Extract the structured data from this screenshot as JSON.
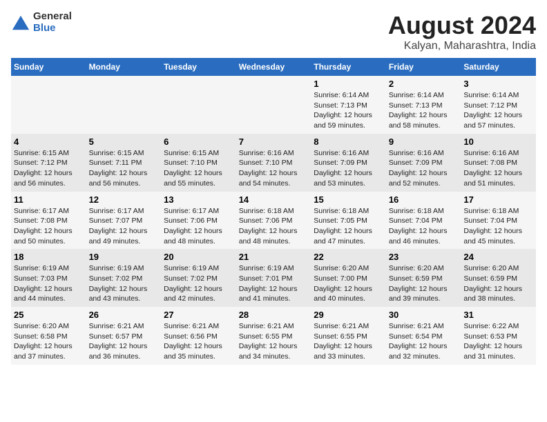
{
  "logo": {
    "general": "General",
    "blue": "Blue"
  },
  "title": "August 2024",
  "subtitle": "Kalyan, Maharashtra, India",
  "days_of_week": [
    "Sunday",
    "Monday",
    "Tuesday",
    "Wednesday",
    "Thursday",
    "Friday",
    "Saturday"
  ],
  "weeks": [
    [
      {
        "day": "",
        "info": ""
      },
      {
        "day": "",
        "info": ""
      },
      {
        "day": "",
        "info": ""
      },
      {
        "day": "",
        "info": ""
      },
      {
        "day": "1",
        "info": "Sunrise: 6:14 AM\nSunset: 7:13 PM\nDaylight: 12 hours\nand 59 minutes."
      },
      {
        "day": "2",
        "info": "Sunrise: 6:14 AM\nSunset: 7:13 PM\nDaylight: 12 hours\nand 58 minutes."
      },
      {
        "day": "3",
        "info": "Sunrise: 6:14 AM\nSunset: 7:12 PM\nDaylight: 12 hours\nand 57 minutes."
      }
    ],
    [
      {
        "day": "4",
        "info": "Sunrise: 6:15 AM\nSunset: 7:12 PM\nDaylight: 12 hours\nand 56 minutes."
      },
      {
        "day": "5",
        "info": "Sunrise: 6:15 AM\nSunset: 7:11 PM\nDaylight: 12 hours\nand 56 minutes."
      },
      {
        "day": "6",
        "info": "Sunrise: 6:15 AM\nSunset: 7:10 PM\nDaylight: 12 hours\nand 55 minutes."
      },
      {
        "day": "7",
        "info": "Sunrise: 6:16 AM\nSunset: 7:10 PM\nDaylight: 12 hours\nand 54 minutes."
      },
      {
        "day": "8",
        "info": "Sunrise: 6:16 AM\nSunset: 7:09 PM\nDaylight: 12 hours\nand 53 minutes."
      },
      {
        "day": "9",
        "info": "Sunrise: 6:16 AM\nSunset: 7:09 PM\nDaylight: 12 hours\nand 52 minutes."
      },
      {
        "day": "10",
        "info": "Sunrise: 6:16 AM\nSunset: 7:08 PM\nDaylight: 12 hours\nand 51 minutes."
      }
    ],
    [
      {
        "day": "11",
        "info": "Sunrise: 6:17 AM\nSunset: 7:08 PM\nDaylight: 12 hours\nand 50 minutes."
      },
      {
        "day": "12",
        "info": "Sunrise: 6:17 AM\nSunset: 7:07 PM\nDaylight: 12 hours\nand 49 minutes."
      },
      {
        "day": "13",
        "info": "Sunrise: 6:17 AM\nSunset: 7:06 PM\nDaylight: 12 hours\nand 48 minutes."
      },
      {
        "day": "14",
        "info": "Sunrise: 6:18 AM\nSunset: 7:06 PM\nDaylight: 12 hours\nand 48 minutes."
      },
      {
        "day": "15",
        "info": "Sunrise: 6:18 AM\nSunset: 7:05 PM\nDaylight: 12 hours\nand 47 minutes."
      },
      {
        "day": "16",
        "info": "Sunrise: 6:18 AM\nSunset: 7:04 PM\nDaylight: 12 hours\nand 46 minutes."
      },
      {
        "day": "17",
        "info": "Sunrise: 6:18 AM\nSunset: 7:04 PM\nDaylight: 12 hours\nand 45 minutes."
      }
    ],
    [
      {
        "day": "18",
        "info": "Sunrise: 6:19 AM\nSunset: 7:03 PM\nDaylight: 12 hours\nand 44 minutes."
      },
      {
        "day": "19",
        "info": "Sunrise: 6:19 AM\nSunset: 7:02 PM\nDaylight: 12 hours\nand 43 minutes."
      },
      {
        "day": "20",
        "info": "Sunrise: 6:19 AM\nSunset: 7:02 PM\nDaylight: 12 hours\nand 42 minutes."
      },
      {
        "day": "21",
        "info": "Sunrise: 6:19 AM\nSunset: 7:01 PM\nDaylight: 12 hours\nand 41 minutes."
      },
      {
        "day": "22",
        "info": "Sunrise: 6:20 AM\nSunset: 7:00 PM\nDaylight: 12 hours\nand 40 minutes."
      },
      {
        "day": "23",
        "info": "Sunrise: 6:20 AM\nSunset: 6:59 PM\nDaylight: 12 hours\nand 39 minutes."
      },
      {
        "day": "24",
        "info": "Sunrise: 6:20 AM\nSunset: 6:59 PM\nDaylight: 12 hours\nand 38 minutes."
      }
    ],
    [
      {
        "day": "25",
        "info": "Sunrise: 6:20 AM\nSunset: 6:58 PM\nDaylight: 12 hours\nand 37 minutes."
      },
      {
        "day": "26",
        "info": "Sunrise: 6:21 AM\nSunset: 6:57 PM\nDaylight: 12 hours\nand 36 minutes."
      },
      {
        "day": "27",
        "info": "Sunrise: 6:21 AM\nSunset: 6:56 PM\nDaylight: 12 hours\nand 35 minutes."
      },
      {
        "day": "28",
        "info": "Sunrise: 6:21 AM\nSunset: 6:55 PM\nDaylight: 12 hours\nand 34 minutes."
      },
      {
        "day": "29",
        "info": "Sunrise: 6:21 AM\nSunset: 6:55 PM\nDaylight: 12 hours\nand 33 minutes."
      },
      {
        "day": "30",
        "info": "Sunrise: 6:21 AM\nSunset: 6:54 PM\nDaylight: 12 hours\nand 32 minutes."
      },
      {
        "day": "31",
        "info": "Sunrise: 6:22 AM\nSunset: 6:53 PM\nDaylight: 12 hours\nand 31 minutes."
      }
    ]
  ]
}
